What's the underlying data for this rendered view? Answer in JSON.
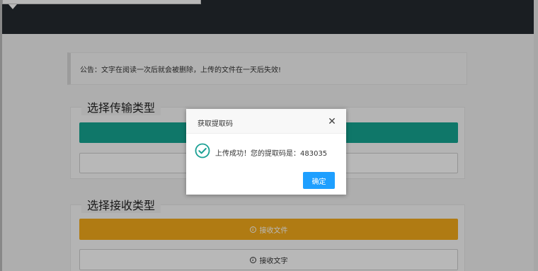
{
  "notice": {
    "text": "公告：文字在阅读一次后就会被删除，上传的文件在一天后失效!"
  },
  "send_section": {
    "title": "选择传输类型",
    "primary_button": "",
    "secondary_button": ""
  },
  "receive_section": {
    "title": "选择接收类型",
    "file_button": "接收文件",
    "text_button": "接收文字"
  },
  "dialog": {
    "title": "获取提取码",
    "close_glyph": "✕",
    "message": "上传成功！您的提取码是：483035",
    "confirm_label": "确定"
  },
  "colors": {
    "topbar": "#252a30",
    "teal": "#16a592",
    "gold": "#f4ab1b",
    "confirm": "#1e9fff",
    "success": "#1aa094"
  },
  "icons": {
    "success": "check-circle-icon",
    "close": "close-icon",
    "download": "download-circle-icon"
  }
}
